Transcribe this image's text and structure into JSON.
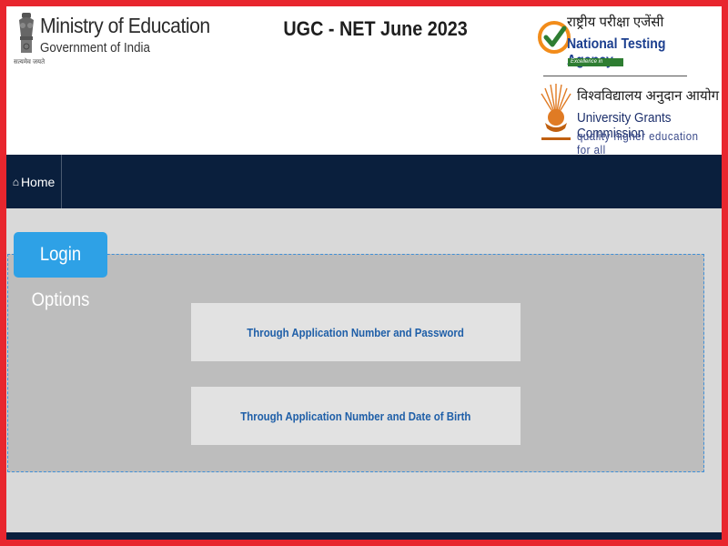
{
  "header": {
    "ministry_title": "Ministry of Education",
    "ministry_subtitle": "Government of India",
    "emblem_caption": "सत्यमेव जयते",
    "exam_title": "UGC - NET June 2023",
    "nta": {
      "hindi_name": "राष्ट्रीय परीक्षा एजेंसी",
      "name": "National Testing Agency",
      "tagline": "Excellence in Assessment"
    },
    "ugc": {
      "hindi_name": "विश्वविद्यालय अनुदान आयोग",
      "name": "University Grants Commission",
      "tagline": "quality higher education for all"
    }
  },
  "navbar": {
    "home_label": "Home",
    "home_icon": "home-icon"
  },
  "login": {
    "title": "Login Options",
    "options": [
      "Through Application Number and Password",
      "Through Application Number and Date of Birth"
    ]
  },
  "colors": {
    "border_red": "#e8262e",
    "navbar_bg": "#0a1f3d",
    "tab_blue": "#2ea1e6",
    "link_blue": "#1f5fa8",
    "nta_green": "#2e7d32"
  }
}
